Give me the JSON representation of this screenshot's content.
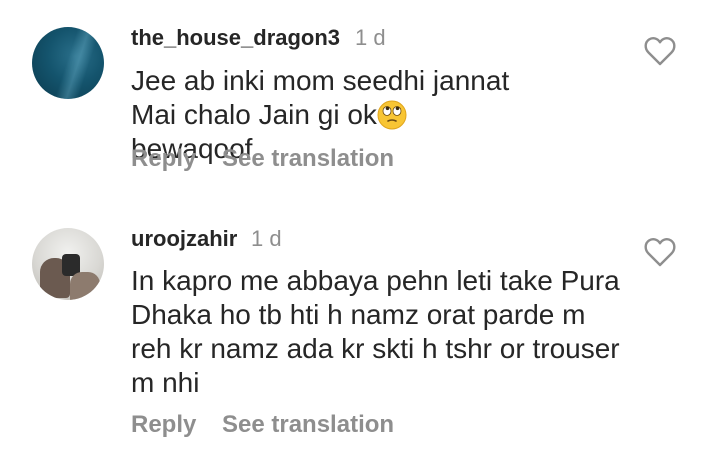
{
  "comments": [
    {
      "username": "the_house_dragon3",
      "time": "1 d",
      "text": "Jee ab inki mom seedhi jannat Mai chalo Jain gi ok",
      "text_after_emoji": " bewaqoof",
      "emoji": "face-with-rolling-eyes",
      "reply_label": "Reply",
      "translate_label": "See translation",
      "like_icon": "heart-outline-icon"
    },
    {
      "username": "uroojzahir",
      "time": "1 d",
      "text": "In kapro me abbaya pehn leti take Pura Dhaka ho tb hti h namz orat parde m reh kr namz ada kr skti h tshr or trouser m nhi",
      "reply_label": "Reply",
      "translate_label": "See translation",
      "like_icon": "heart-outline-icon"
    }
  ],
  "colors": {
    "text": "#262626",
    "secondary": "#8e8e8e",
    "background": "#ffffff"
  }
}
